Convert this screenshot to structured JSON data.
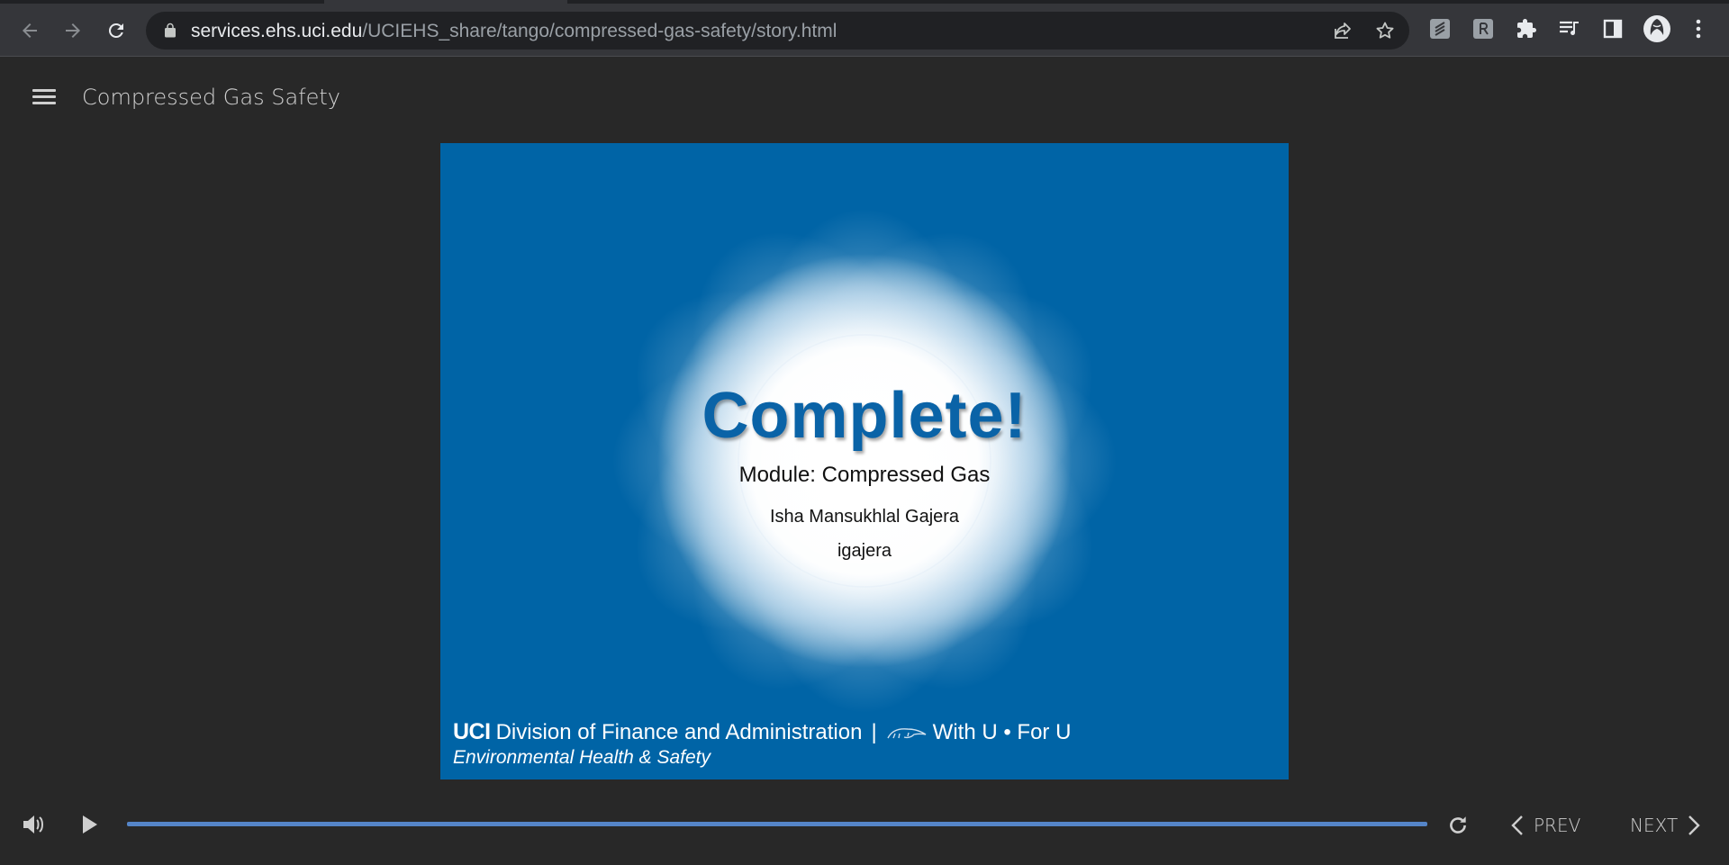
{
  "browser": {
    "url_host": "services.ehs.uci.edu",
    "url_path": "/UCIEHS_share/tango/compressed-gas-safety/story.html",
    "icons": [
      "back-icon",
      "forward-icon",
      "reload-icon",
      "lock-icon",
      "share-icon",
      "bookmark-star-icon",
      "extension-icon",
      "reader-extension-icon",
      "puzzle-extensions-icon",
      "media-control-icon",
      "side-panel-icon",
      "profile-avatar-icon",
      "kebab-menu-icon"
    ]
  },
  "header": {
    "course_title": "Compressed Gas Safety"
  },
  "slide": {
    "title": "Complete!",
    "module": "Module: Compressed Gas",
    "learner_name": "Isha Mansukhlal Gajera",
    "username": "igajera",
    "footer": {
      "logo": "UCI",
      "division": "Division of Finance and Administration",
      "divider": "|",
      "tagline": "With U • For U",
      "department": "Environmental Health & Safety"
    },
    "colors": {
      "background": "#0064a6",
      "title": "#0a63a7"
    }
  },
  "player": {
    "progress": 1.0,
    "prev_label": "PREV",
    "next_label": "NEXT",
    "accent": "#5585c8"
  }
}
